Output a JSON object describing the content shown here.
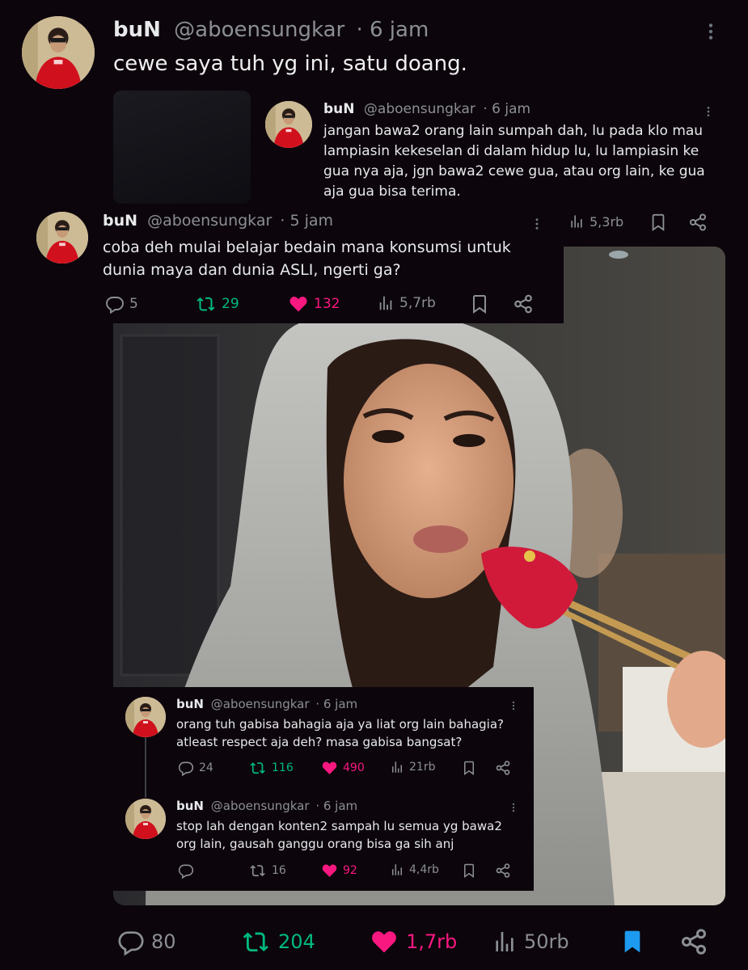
{
  "main_tweet": {
    "name": "buN",
    "handle": "@aboensungkar",
    "time": "· 6 jam",
    "text": "cewe saya tuh yg ini, satu doang.",
    "stats": {
      "replies": "80",
      "retweets": "204",
      "likes": "1,7rb",
      "views": "50rb"
    }
  },
  "quote_top": {
    "name": "buN",
    "handle": "@aboensungkar",
    "time": "· 6 jam",
    "text": "jangan bawa2 orang lain sumpah dah, lu pada klo mau lampiasin kekeselan di dalam hidup lu, lu lampiasin ke gua nya aja, jgn bawa2 cewe gua, atau org lain, ke gua aja gua bisa terima.",
    "stats": {
      "views": "5,3rb"
    }
  },
  "quote_mid": {
    "name": "buN",
    "handle": "@aboensungkar",
    "time": "· 5 jam",
    "text": "coba deh mulai belajar bedain mana konsumsi untuk dunia maya dan dunia ASLI, ngerti ga?",
    "stats": {
      "replies": "5",
      "retweets": "29",
      "likes": "132",
      "views": "5,7rb"
    }
  },
  "quote_bottom_1": {
    "name": "buN",
    "handle": "@aboensungkar",
    "time": "· 6 jam",
    "text": "orang tuh gabisa bahagia aja ya liat org lain bahagia? atleast respect aja deh? masa gabisa bangsat?",
    "stats": {
      "replies": "24",
      "retweets": "116",
      "likes": "490",
      "views": "21rb"
    }
  },
  "quote_bottom_2": {
    "name": "buN",
    "handle": "@aboensungkar",
    "time": "· 6 jam",
    "text": "stop lah dengan konten2 sampah lu semua yg bawa2 org lain, gausah ganggu orang bisa ga sih anj",
    "stats": {
      "replies": "",
      "retweets": "16",
      "likes": "92",
      "views": "4,4rb"
    }
  },
  "colors": {
    "retweet": "#00ba7c",
    "like": "#f91880",
    "bookmark_active": "#1d9bf0",
    "muted": "#8b8f94"
  },
  "icons": [
    "reply-icon",
    "retweet-icon",
    "like-icon",
    "views-icon",
    "bookmark-icon",
    "share-icon",
    "more-icon"
  ]
}
